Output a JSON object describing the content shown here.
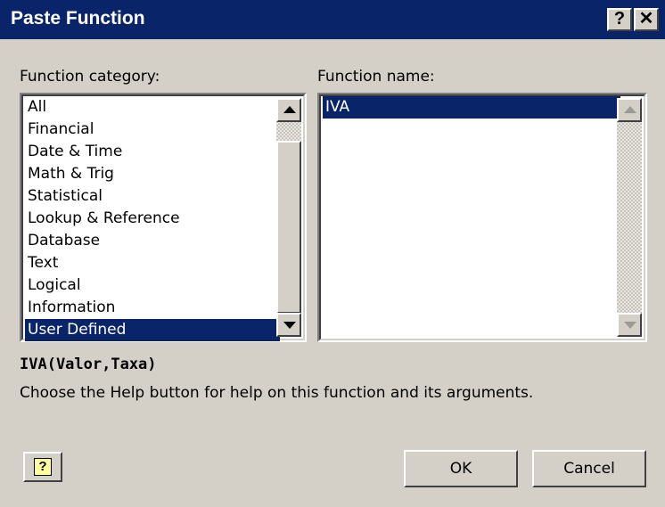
{
  "window": {
    "title": "Paste Function",
    "help_button": "?",
    "close_button": "✕"
  },
  "category": {
    "label": "Function category:",
    "items": [
      "All",
      "Financial",
      "Date & Time",
      "Math & Trig",
      "Statistical",
      "Lookup & Reference",
      "Database",
      "Text",
      "Logical",
      "Information",
      "User Defined"
    ],
    "selected": "User Defined"
  },
  "function_list": {
    "label": "Function name:",
    "items": [
      "IVA"
    ],
    "selected": "IVA"
  },
  "syntax": "IVA(Valor,Taxa)",
  "description": "Choose the Help button for help on this function and its arguments.",
  "buttons": {
    "ok": "OK",
    "cancel": "Cancel",
    "help_icon": "?"
  },
  "colors": {
    "titlebar": "#0a246a",
    "dialog": "#d4d0c8",
    "selection": "#0a246a"
  },
  "icons": [
    "question-mark-icon",
    "close-icon",
    "scroll-up-arrow-icon",
    "scroll-down-arrow-icon",
    "help-icon"
  ]
}
